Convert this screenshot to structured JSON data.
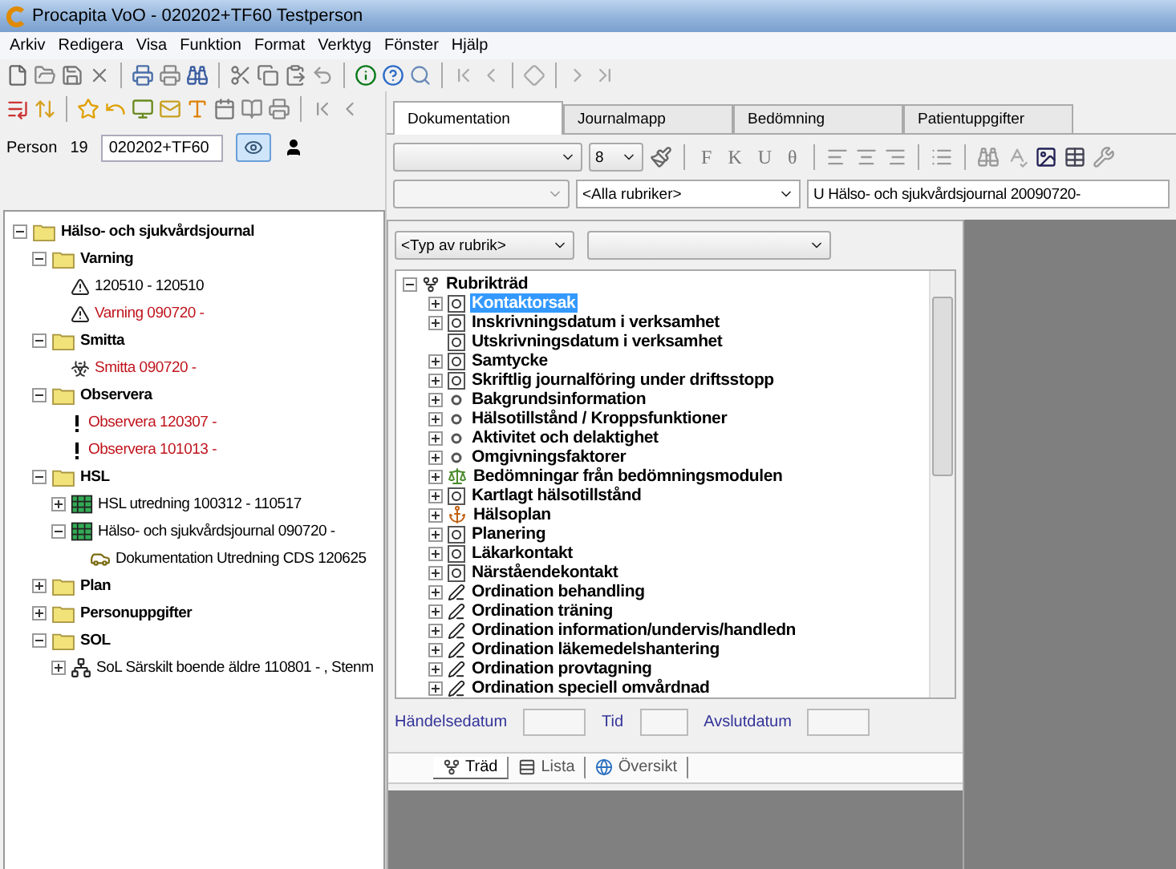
{
  "window": {
    "title": "Procapita VoO - 020202+TF60 Testperson"
  },
  "menu": [
    "Arkiv",
    "Redigera",
    "Visa",
    "Funktion",
    "Format",
    "Verktyg",
    "Fönster",
    "Hjälp"
  ],
  "person": {
    "label": "Person",
    "number": "19",
    "id": "020202+TF60"
  },
  "journal_tree": [
    {
      "label": "Hälso- och sjukvårdsjournal",
      "kind": "folder",
      "expanded": true,
      "children": [
        {
          "label": "Varning",
          "kind": "folder",
          "expanded": true,
          "children": [
            {
              "label": "120510 - 120510",
              "kind": "warning",
              "urgent": false
            },
            {
              "label": "Varning 090720 -",
              "kind": "warning",
              "urgent": true
            }
          ]
        },
        {
          "label": "Smitta",
          "kind": "folder",
          "expanded": true,
          "children": [
            {
              "label": "Smitta 090720 -",
              "kind": "biohazard",
              "urgent": true
            }
          ]
        },
        {
          "label": "Observera",
          "kind": "folder",
          "expanded": true,
          "children": [
            {
              "label": "Observera 120307 -",
              "kind": "exclamation",
              "urgent": true
            },
            {
              "label": "Observera 101013 -",
              "kind": "exclamation",
              "urgent": true
            }
          ]
        },
        {
          "label": "HSL",
          "kind": "folder",
          "expanded": true,
          "children": [
            {
              "label": "HSL utredning 100312 - 110517",
              "kind": "record",
              "urgent": false,
              "expanded": false
            },
            {
              "label": "Hälso- och sjukvårdsjournal 090720 -",
              "kind": "record",
              "urgent": false,
              "expanded": true,
              "children": [
                {
                  "label": "Dokumentation Utredning CDS 120625",
                  "kind": "car",
                  "urgent": false
                }
              ]
            }
          ]
        },
        {
          "label": "Plan",
          "kind": "folder",
          "expanded": false
        },
        {
          "label": "Personuppgifter",
          "kind": "folder",
          "expanded": false
        },
        {
          "label": "SOL",
          "kind": "folder",
          "expanded": true,
          "children": [
            {
              "label": "SoL Särskilt boende äldre 110801 - , Stenm",
              "kind": "network",
              "urgent": false,
              "expanded": false
            }
          ]
        }
      ]
    }
  ],
  "tabs": [
    {
      "label": "Dokumentation",
      "selected": true
    },
    {
      "label": "Journalmapp",
      "selected": false
    },
    {
      "label": "Bedömning",
      "selected": false
    },
    {
      "label": "Patientuppgifter",
      "selected": false
    }
  ],
  "format_bar": {
    "font_size": "8",
    "style_buttons": [
      "F",
      "K",
      "U",
      "θ"
    ]
  },
  "filter_bar": {
    "headings": "<Alla rubriker>",
    "journal": "U Hälso- och sjukvårdsjournal 20090720-"
  },
  "heading_type": {
    "type": "<Typ av rubrik>"
  },
  "rubrik_tree": {
    "label": "Rubrikträd",
    "expanded": true,
    "children": [
      {
        "label": "Kontaktorsak",
        "kind": "form",
        "expandable": true,
        "selected": true
      },
      {
        "label": "Inskrivningsdatum i verksamhet",
        "kind": "form",
        "expandable": true,
        "selected": false
      },
      {
        "label": "Utskrivningsdatum i verksamhet",
        "kind": "form",
        "expandable": false,
        "selected": false
      },
      {
        "label": "Samtycke",
        "kind": "form",
        "expandable": true,
        "selected": false
      },
      {
        "label": "Skriftlig journalföring under driftsstopp",
        "kind": "form",
        "expandable": true,
        "selected": false
      },
      {
        "label": "Bakgrundsinformation",
        "kind": "dot",
        "expandable": true,
        "selected": false
      },
      {
        "label": "Hälsotillstånd / Kroppsfunktioner",
        "kind": "dot",
        "expandable": true,
        "selected": false
      },
      {
        "label": "Aktivitet och delaktighet",
        "kind": "dot",
        "expandable": true,
        "selected": false
      },
      {
        "label": "Omgivningsfaktorer",
        "kind": "dot",
        "expandable": true,
        "selected": false
      },
      {
        "label": "Bedömningar från bedömningsmodulen",
        "kind": "scale",
        "expandable": true,
        "selected": false
      },
      {
        "label": "Kartlagt hälsotillstånd",
        "kind": "form",
        "expandable": true,
        "selected": false
      },
      {
        "label": "Hälsoplan",
        "kind": "plan",
        "expandable": true,
        "selected": false
      },
      {
        "label": "Planering",
        "kind": "form",
        "expandable": true,
        "selected": false
      },
      {
        "label": "Läkarkontakt",
        "kind": "form",
        "expandable": true,
        "selected": false
      },
      {
        "label": "Närståendekontakt",
        "kind": "form",
        "expandable": true,
        "selected": false
      },
      {
        "label": "Ordination behandling",
        "kind": "pen",
        "expandable": true,
        "selected": false
      },
      {
        "label": "Ordination träning",
        "kind": "pen",
        "expandable": true,
        "selected": false
      },
      {
        "label": "Ordination information/undervis/handledn",
        "kind": "pen",
        "expandable": true,
        "selected": false
      },
      {
        "label": "Ordination läkemedelshantering",
        "kind": "pen",
        "expandable": true,
        "selected": false
      },
      {
        "label": "Ordination provtagning",
        "kind": "pen",
        "expandable": true,
        "selected": false
      },
      {
        "label": "Ordination speciell omvårdnad",
        "kind": "pen",
        "expandable": true,
        "selected": false
      }
    ]
  },
  "date_fields": [
    "Händelsedatum",
    "Tid",
    "Avslutdatum"
  ],
  "view_tabs": [
    {
      "label": "Träd",
      "kind": "tree",
      "selected": true
    },
    {
      "label": "Lista",
      "kind": "list",
      "selected": false
    },
    {
      "label": "Översikt",
      "kind": "overview",
      "selected": false
    }
  ]
}
